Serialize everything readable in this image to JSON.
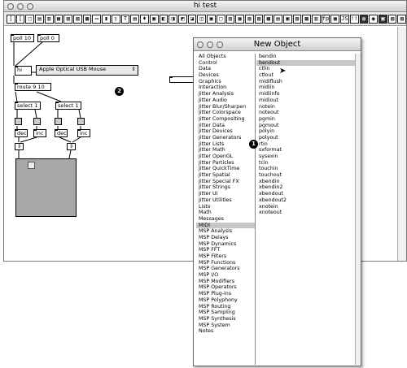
{
  "window": {
    "title": "hi test"
  },
  "toolbar": [
    "[",
    "[",
    "▢",
    "▤",
    "▥",
    "▦",
    "▧",
    "▨",
    "▩",
    "▭",
    "▮",
    "▯",
    "T",
    "▤",
    "♦",
    "▣",
    "◧",
    "◨",
    "◩",
    "◪",
    "◫",
    "▣",
    "▢",
    "▥",
    "▦",
    "▧",
    "▨",
    "▩",
    "▤",
    "▣",
    "▨",
    "▩",
    "▥",
    "fps",
    "▦",
    "JS",
    "!!!",
    "◍",
    "◉",
    "▣",
    "▧",
    "▨"
  ],
  "patch": {
    "poll10": "poll 10",
    "poll0": "poll 0",
    "hi": "hi",
    "device_menu": "Apple Optical USB Mouse",
    "route": "route 9 10",
    "select1a": "select 1",
    "select1b": "select 1",
    "dec_a": "dec",
    "inc_a": "inc",
    "dec_b": "dec",
    "inc_b": "inc",
    "badge2": "2"
  },
  "dialog": {
    "title": "New Object",
    "badge1": "1",
    "categories": [
      "All Objects",
      "Control",
      "Data",
      "Devices",
      "Graphics",
      "Interaction",
      "Jitter Analysis",
      "Jitter Audio",
      "Jitter Blur/Sharpen",
      "Jitter Colorspace",
      "Jitter Compositing",
      "Jitter Data",
      "Jitter Devices",
      "Jitter Generators",
      "Jitter Lists",
      "Jitter Math",
      "Jitter OpenGL",
      "Jitter Particles",
      "Jitter QuickTime",
      "Jitter Spatial",
      "Jitter Special FX",
      "Jitter Strings",
      "Jitter UI",
      "Jitter Utilities",
      "Lists",
      "Math",
      "Messages",
      "MIDI",
      "MSP Analysis",
      "MSP Delays",
      "MSP Dynamics",
      "MSP FFT",
      "MSP Filters",
      "MSP Functions",
      "MSP Generators",
      "MSP I/O",
      "MSP Modifiers",
      "MSP Operators",
      "MSP Plug-ins",
      "MSP Polyphony",
      "MSP Routing",
      "MSP Sampling",
      "MSP Synthesis",
      "MSP System",
      "Notes"
    ],
    "selected_category": "MIDI",
    "objects": [
      "bendin",
      "bendout",
      "ctlin",
      "ctlout",
      "midiflush",
      "midiin",
      "midiinfo",
      "midiout",
      "notein",
      "noteout",
      "pgmin",
      "pgmout",
      "polyin",
      "polyout",
      "rtin",
      "sxformat",
      "sysexin",
      "tcin",
      "touchin",
      "touchout",
      "xbendin",
      "xbendin2",
      "xbendout",
      "xbendout2",
      "xnotein",
      "xnoteout"
    ],
    "selected_object": "bendout"
  }
}
